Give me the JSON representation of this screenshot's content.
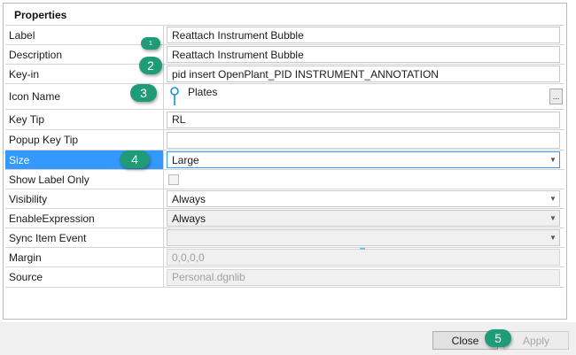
{
  "panel": {
    "title": "Properties"
  },
  "rows": {
    "label": {
      "name": "Label",
      "value": "Reattach Instrument Bubble"
    },
    "description": {
      "name": "Description",
      "value": "Reattach Instrument Bubble"
    },
    "keyin": {
      "name": "Key-in",
      "value": "pid insert OpenPlant_PID INSTRUMENT_ANNOTATION"
    },
    "icon_name": {
      "name": "Icon Name",
      "value": "Plates",
      "browse": "..."
    },
    "key_tip": {
      "name": "Key Tip",
      "value": "RL"
    },
    "popup_key_tip": {
      "name": "Popup Key Tip",
      "value": ""
    },
    "size": {
      "name": "Size",
      "value": "Large"
    },
    "show_label_only": {
      "name": "Show Label Only",
      "checked": false
    },
    "visibility": {
      "name": "Visibility",
      "value": "Always"
    },
    "enable_expression": {
      "name": "EnableExpression",
      "value": "Always"
    },
    "sync_item_event": {
      "name": "Sync Item Event",
      "value": ""
    },
    "margin": {
      "name": "Margin",
      "value": "0,0,0,0"
    },
    "source": {
      "name": "Source",
      "value": "Personal.dgnlib"
    }
  },
  "callouts": [
    "1",
    "2",
    "3",
    "4",
    "5"
  ],
  "buttons": {
    "close": "Close",
    "apply": "Apply"
  },
  "colors": {
    "selection": "#3399ff",
    "callout": "#1f9b77",
    "icon": "#1b8fd1"
  },
  "icons": {
    "dropdown": "chevron-down-icon",
    "icon_preview": "pin-icon"
  }
}
